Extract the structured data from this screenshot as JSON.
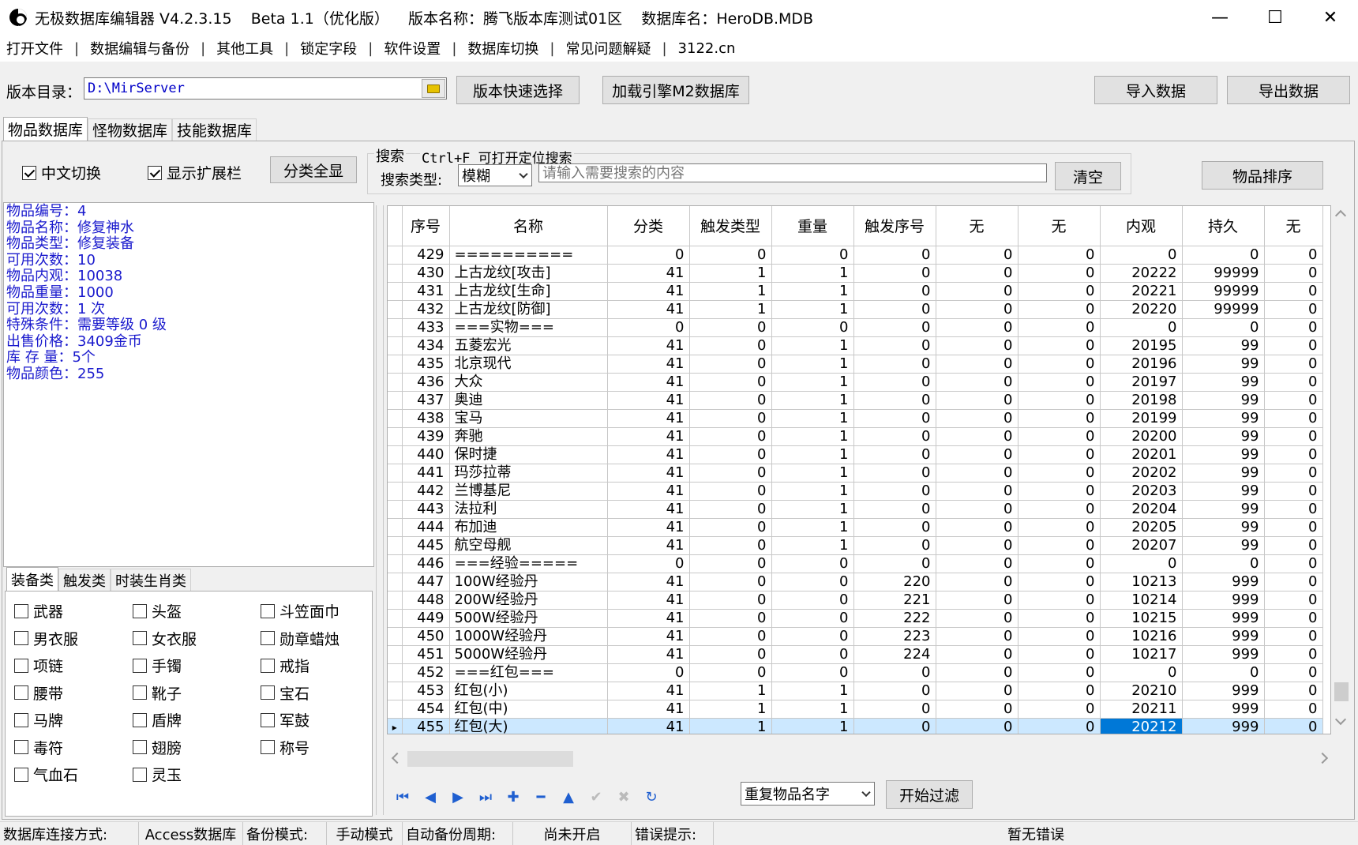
{
  "window": {
    "title": "无极数据库编辑器 V4.2.3.15    Beta 1.1（优化版）    版本名称：腾飞版本库测试01区    数据库名：HeroDB.MDB",
    "minimize": "—",
    "maximize": "☐",
    "close": "✕"
  },
  "menu": [
    "打开文件",
    "数据编辑与备份",
    "其他工具",
    "锁定字段",
    "软件设置",
    "数据库切换",
    "常见问题解疑",
    "3122.cn"
  ],
  "menu_sep": "|",
  "top": {
    "dir_label": "版本目录：",
    "dir_value": "D:\\MirServer",
    "quick_select": "版本快速选择",
    "load_m2": "加载引擎M2数据库",
    "import": "导入数据",
    "export": "导出数据"
  },
  "db_tabs": [
    "物品数据库",
    "怪物数据库",
    "技能数据库"
  ],
  "options": {
    "cn_switch": "中文切换",
    "show_ext": "显示扩展栏",
    "show_all_cat": "分类全显",
    "search_title": "搜索",
    "search_hint": "Ctrl+F 可打开定位搜索",
    "search_type_label": "搜索类型:",
    "search_type_value": "模糊",
    "search_placeholder": "请输入需要搜索的内容",
    "clear": "清空",
    "sort": "物品排序"
  },
  "item_info": [
    "物品编号：4",
    "物品名称：修复神水",
    "物品类型：修复装备",
    "可用次数：10",
    "物品内观：10038",
    "物品重量：1000",
    "可用次数：1 次",
    "特殊条件：需要等级 0 级",
    "出售价格：3409金币",
    "库 存 量：5个",
    "物品颜色：255"
  ],
  "cat_tabs": [
    "装备类",
    "触发类",
    "时装生肖类"
  ],
  "categories": [
    [
      "武器",
      "头盔",
      "斗笠面巾"
    ],
    [
      "男衣服",
      "女衣服",
      "勋章蜡烛"
    ],
    [
      "项链",
      "手镯",
      "戒指"
    ],
    [
      "腰带",
      "靴子",
      "宝石"
    ],
    [
      "马牌",
      "盾牌",
      "军鼓"
    ],
    [
      "毒符",
      "翅膀",
      "称号"
    ],
    [
      "气血石",
      "灵玉"
    ]
  ],
  "grid": {
    "columns": [
      "序号",
      "名称",
      "分类",
      "触发类型",
      "重量",
      "触发序号",
      "无",
      "无",
      "内观",
      "持久",
      "无"
    ],
    "rows": [
      [
        "429",
        "==========",
        "0",
        "0",
        "0",
        "0",
        "0",
        "0",
        "0",
        "0",
        "0"
      ],
      [
        "430",
        "上古龙纹[攻击]",
        "41",
        "1",
        "1",
        "0",
        "0",
        "0",
        "20222",
        "99999",
        "0"
      ],
      [
        "431",
        "上古龙纹[生命]",
        "41",
        "1",
        "1",
        "0",
        "0",
        "0",
        "20221",
        "99999",
        "0"
      ],
      [
        "432",
        "上古龙纹[防御]",
        "41",
        "1",
        "1",
        "0",
        "0",
        "0",
        "20220",
        "99999",
        "0"
      ],
      [
        "433",
        "===实物===",
        "0",
        "0",
        "0",
        "0",
        "0",
        "0",
        "0",
        "0",
        "0"
      ],
      [
        "434",
        "五菱宏光",
        "41",
        "0",
        "1",
        "0",
        "0",
        "0",
        "20195",
        "99",
        "0"
      ],
      [
        "435",
        "北京现代",
        "41",
        "0",
        "1",
        "0",
        "0",
        "0",
        "20196",
        "99",
        "0"
      ],
      [
        "436",
        "大众",
        "41",
        "0",
        "1",
        "0",
        "0",
        "0",
        "20197",
        "99",
        "0"
      ],
      [
        "437",
        "奥迪",
        "41",
        "0",
        "1",
        "0",
        "0",
        "0",
        "20198",
        "99",
        "0"
      ],
      [
        "438",
        "宝马",
        "41",
        "0",
        "1",
        "0",
        "0",
        "0",
        "20199",
        "99",
        "0"
      ],
      [
        "439",
        "奔驰",
        "41",
        "0",
        "1",
        "0",
        "0",
        "0",
        "20200",
        "99",
        "0"
      ],
      [
        "440",
        "保时捷",
        "41",
        "0",
        "1",
        "0",
        "0",
        "0",
        "20201",
        "99",
        "0"
      ],
      [
        "441",
        "玛莎拉蒂",
        "41",
        "0",
        "1",
        "0",
        "0",
        "0",
        "20202",
        "99",
        "0"
      ],
      [
        "442",
        "兰博基尼",
        "41",
        "0",
        "1",
        "0",
        "0",
        "0",
        "20203",
        "99",
        "0"
      ],
      [
        "443",
        "法拉利",
        "41",
        "0",
        "1",
        "0",
        "0",
        "0",
        "20204",
        "99",
        "0"
      ],
      [
        "444",
        "布加迪",
        "41",
        "0",
        "1",
        "0",
        "0",
        "0",
        "20205",
        "99",
        "0"
      ],
      [
        "445",
        "航空母舰",
        "41",
        "0",
        "1",
        "0",
        "0",
        "0",
        "20207",
        "99",
        "0"
      ],
      [
        "446",
        "===经验=====",
        "0",
        "0",
        "0",
        "0",
        "0",
        "0",
        "0",
        "0",
        "0"
      ],
      [
        "447",
        "100W经验丹",
        "41",
        "0",
        "0",
        "220",
        "0",
        "0",
        "10213",
        "999",
        "0"
      ],
      [
        "448",
        "200W经验丹",
        "41",
        "0",
        "0",
        "221",
        "0",
        "0",
        "10214",
        "999",
        "0"
      ],
      [
        "449",
        "500W经验丹",
        "41",
        "0",
        "0",
        "222",
        "0",
        "0",
        "10215",
        "999",
        "0"
      ],
      [
        "450",
        "1000W经验丹",
        "41",
        "0",
        "0",
        "223",
        "0",
        "0",
        "10216",
        "999",
        "0"
      ],
      [
        "451",
        "5000W经验丹",
        "41",
        "0",
        "0",
        "224",
        "0",
        "0",
        "10217",
        "999",
        "0"
      ],
      [
        "452",
        "===红包===",
        "0",
        "0",
        "0",
        "0",
        "0",
        "0",
        "0",
        "0",
        "0"
      ],
      [
        "453",
        "红包(小)",
        "41",
        "1",
        "1",
        "0",
        "0",
        "0",
        "20210",
        "999",
        "0"
      ],
      [
        "454",
        "红包(中)",
        "41",
        "1",
        "1",
        "0",
        "0",
        "0",
        "20211",
        "999",
        "0"
      ],
      [
        "455",
        "红包(大)",
        "41",
        "1",
        "1",
        "0",
        "0",
        "0",
        "20212",
        "999",
        "0"
      ]
    ],
    "selected_row": "455",
    "row_marker": "▸"
  },
  "bottom": {
    "dup_select": "重复物品名字",
    "start_filter": "开始过滤"
  },
  "status": {
    "conn_label": "数据库连接方式:",
    "conn_value": "Access数据库",
    "backup_label": "备份模式:",
    "backup_value": "手动模式",
    "auto_label": "自动备份周期:",
    "auto_value": "尚未开启",
    "err_label": "错误提示:",
    "err_value": "暂无错误"
  }
}
